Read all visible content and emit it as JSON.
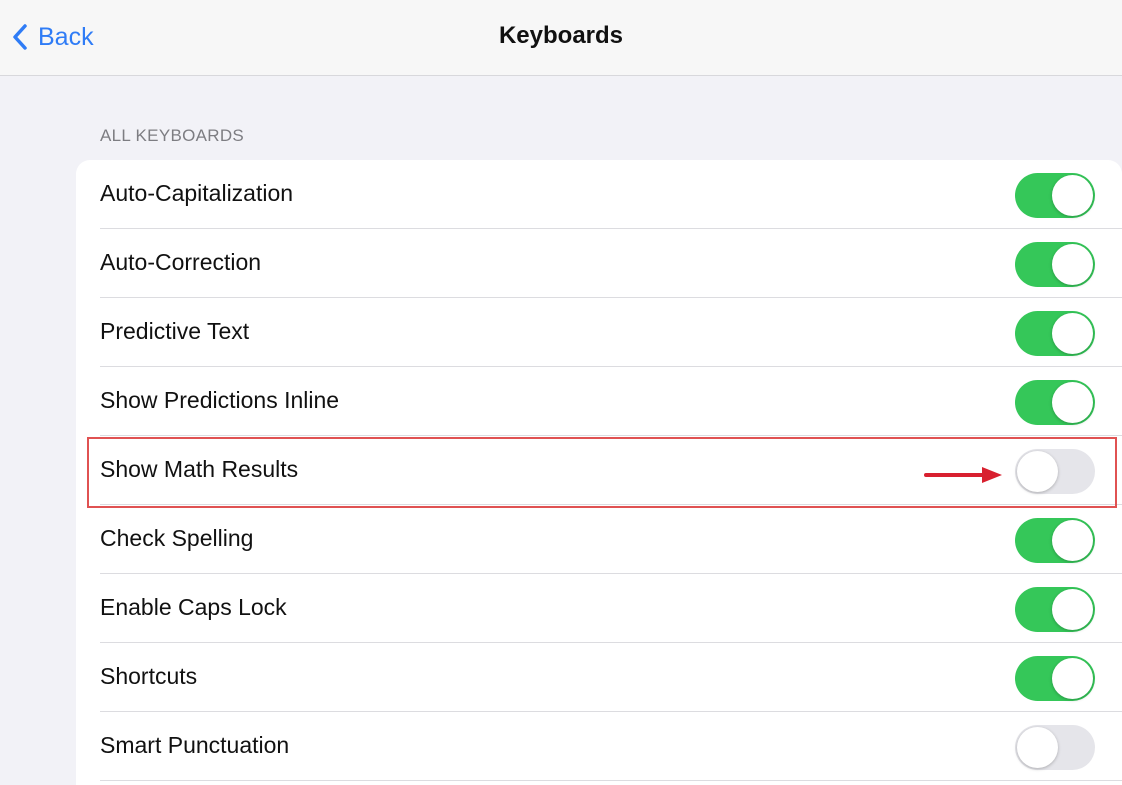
{
  "navbar": {
    "back_label": "Back",
    "title": "Keyboards"
  },
  "section": {
    "header": "ALL KEYBOARDS"
  },
  "settings": [
    {
      "label": "Auto-Capitalization",
      "enabled": true
    },
    {
      "label": "Auto-Correction",
      "enabled": true
    },
    {
      "label": "Predictive Text",
      "enabled": true
    },
    {
      "label": "Show Predictions Inline",
      "enabled": true
    },
    {
      "label": "Show Math Results",
      "enabled": false,
      "highlighted": true
    },
    {
      "label": "Check Spelling",
      "enabled": true
    },
    {
      "label": "Enable Caps Lock",
      "enabled": true
    },
    {
      "label": "Shortcuts",
      "enabled": true
    },
    {
      "label": "Smart Punctuation",
      "enabled": false
    }
  ],
  "colors": {
    "accent": "#2f7cf6",
    "toggle_on": "#35c759",
    "toggle_off": "#e5e5ea",
    "highlight": "#e05252",
    "arrow": "#d8202f"
  }
}
